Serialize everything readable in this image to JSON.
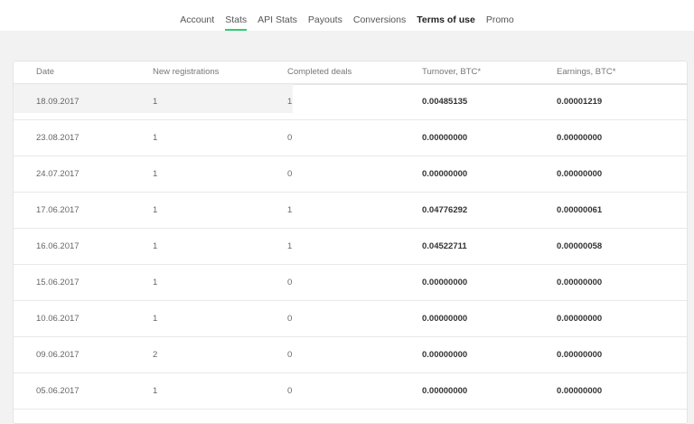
{
  "nav": {
    "items": [
      {
        "label": "Account",
        "active": false,
        "bold": false
      },
      {
        "label": "Stats",
        "active": true,
        "bold": false
      },
      {
        "label": "API Stats",
        "active": false,
        "bold": false
      },
      {
        "label": "Payouts",
        "active": false,
        "bold": false
      },
      {
        "label": "Conversions",
        "active": false,
        "bold": false
      },
      {
        "label": "Terms of use",
        "active": false,
        "bold": true
      },
      {
        "label": "Promo",
        "active": false,
        "bold": false
      }
    ]
  },
  "colors": {
    "accent": "#2ecc71",
    "background": "#f2f2f2"
  },
  "table": {
    "columns": [
      "Date",
      "New registrations",
      "Completed deals",
      "Turnover, BTC*",
      "Earnings, BTC*"
    ],
    "rows": [
      {
        "date": "18.09.2017",
        "registrations": "1",
        "deals": "1",
        "turnover": "0.00485135",
        "earnings": "0.00001219"
      },
      {
        "date": "23.08.2017",
        "registrations": "1",
        "deals": "0",
        "turnover": "0.00000000",
        "earnings": "0.00000000"
      },
      {
        "date": "24.07.2017",
        "registrations": "1",
        "deals": "0",
        "turnover": "0.00000000",
        "earnings": "0.00000000"
      },
      {
        "date": "17.06.2017",
        "registrations": "1",
        "deals": "1",
        "turnover": "0.04776292",
        "earnings": "0.00000061"
      },
      {
        "date": "16.06.2017",
        "registrations": "1",
        "deals": "1",
        "turnover": "0.04522711",
        "earnings": "0.00000058"
      },
      {
        "date": "15.06.2017",
        "registrations": "1",
        "deals": "0",
        "turnover": "0.00000000",
        "earnings": "0.00000000"
      },
      {
        "date": "10.06.2017",
        "registrations": "1",
        "deals": "0",
        "turnover": "0.00000000",
        "earnings": "0.00000000"
      },
      {
        "date": "09.06.2017",
        "registrations": "2",
        "deals": "0",
        "turnover": "0.00000000",
        "earnings": "0.00000000"
      },
      {
        "date": "05.06.2017",
        "registrations": "1",
        "deals": "0",
        "turnover": "0.00000000",
        "earnings": "0.00000000"
      }
    ]
  }
}
